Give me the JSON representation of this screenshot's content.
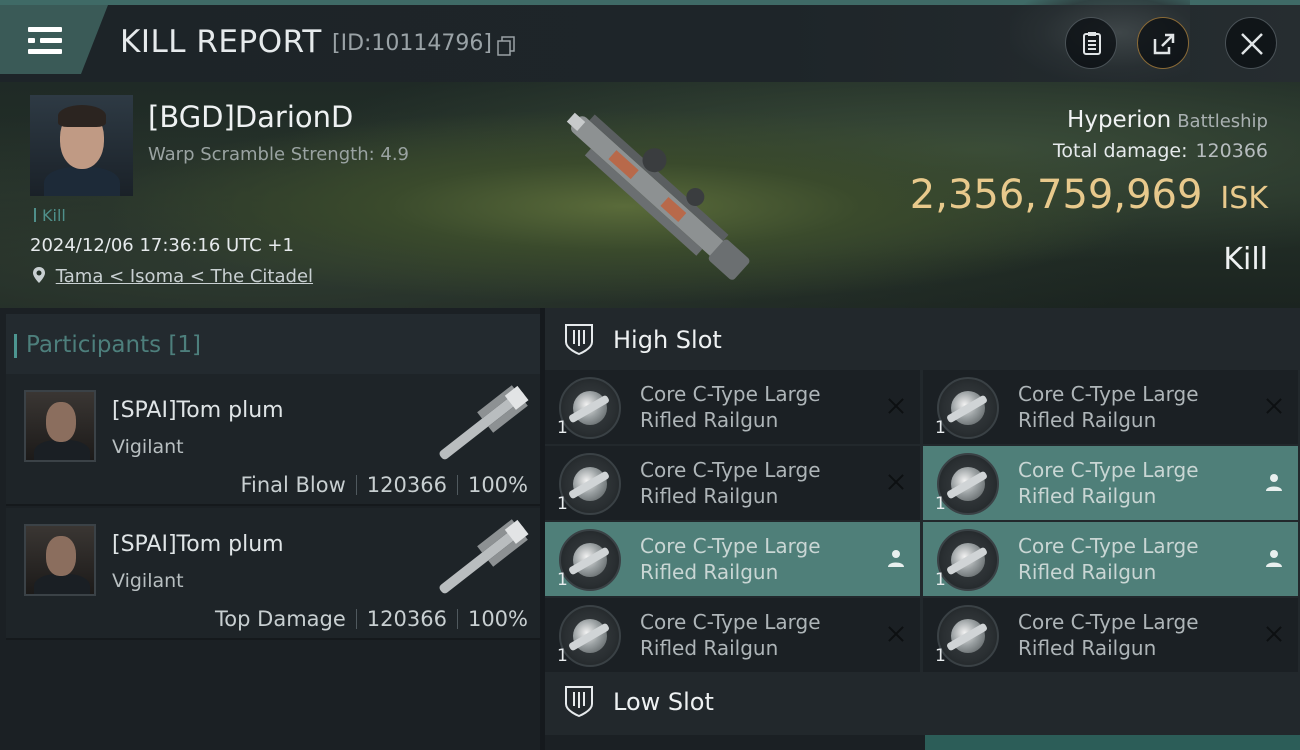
{
  "topbar": {
    "title": "KILL REPORT",
    "report_id": "[ID:10114796]",
    "icons": [
      "menu-icon",
      "copy-icon",
      "clipboard-icon",
      "share-icon",
      "close-icon"
    ]
  },
  "victim": {
    "pilot": "[BGD]DarionD",
    "scramble": "Warp Scramble Strength: 4.9",
    "kill_tag": "Kill",
    "timestamp": "2024/12/06 17:36:16 UTC +1",
    "location": "Tama < Isoma < The Citadel",
    "ship": "Hyperion",
    "ship_class": "Battleship",
    "total_damage_label": "Total damage:",
    "total_damage": "120366",
    "isk_value": "2,356,759,969",
    "isk_unit": "ISK",
    "result": "Kill"
  },
  "participants": {
    "title": "Participants [1]",
    "items": [
      {
        "name": "[SPAI]Tom plum",
        "ship": "Vigilant",
        "role": "Final Blow",
        "damage": "120366",
        "percent": "100%"
      },
      {
        "name": "[SPAI]Tom plum",
        "ship": "Vigilant",
        "role": "Top Damage",
        "damage": "120366",
        "percent": "100%"
      }
    ]
  },
  "slots": {
    "high_label": "High Slot",
    "low_label": "Low Slot",
    "modules": [
      {
        "line1": "Core C-Type Large",
        "line2": "Rifled Railgun",
        "qty": "1",
        "status": "destroyed"
      },
      {
        "line1": "Core C-Type Large",
        "line2": "Rifled Railgun",
        "qty": "1",
        "status": "destroyed"
      },
      {
        "line1": "Core C-Type Large",
        "line2": "Rifled Railgun",
        "qty": "1",
        "status": "destroyed"
      },
      {
        "line1": "Core C-Type Large",
        "line2": "Rifled Railgun",
        "qty": "1",
        "status": "dropped"
      },
      {
        "line1": "Core C-Type Large",
        "line2": "Rifled Railgun",
        "qty": "1",
        "status": "dropped"
      },
      {
        "line1": "Core C-Type Large",
        "line2": "Rifled Railgun",
        "qty": "1",
        "status": "dropped"
      },
      {
        "line1": "Core C-Type Large",
        "line2": "Rifled Railgun",
        "qty": "1",
        "status": "destroyed"
      },
      {
        "line1": "Core C-Type Large",
        "line2": "Rifled Railgun",
        "qty": "1",
        "status": "destroyed"
      }
    ]
  },
  "colors": {
    "accent": "#4f7f79",
    "isk_gold": "#e8c98c",
    "menu": "#3a5a57"
  }
}
